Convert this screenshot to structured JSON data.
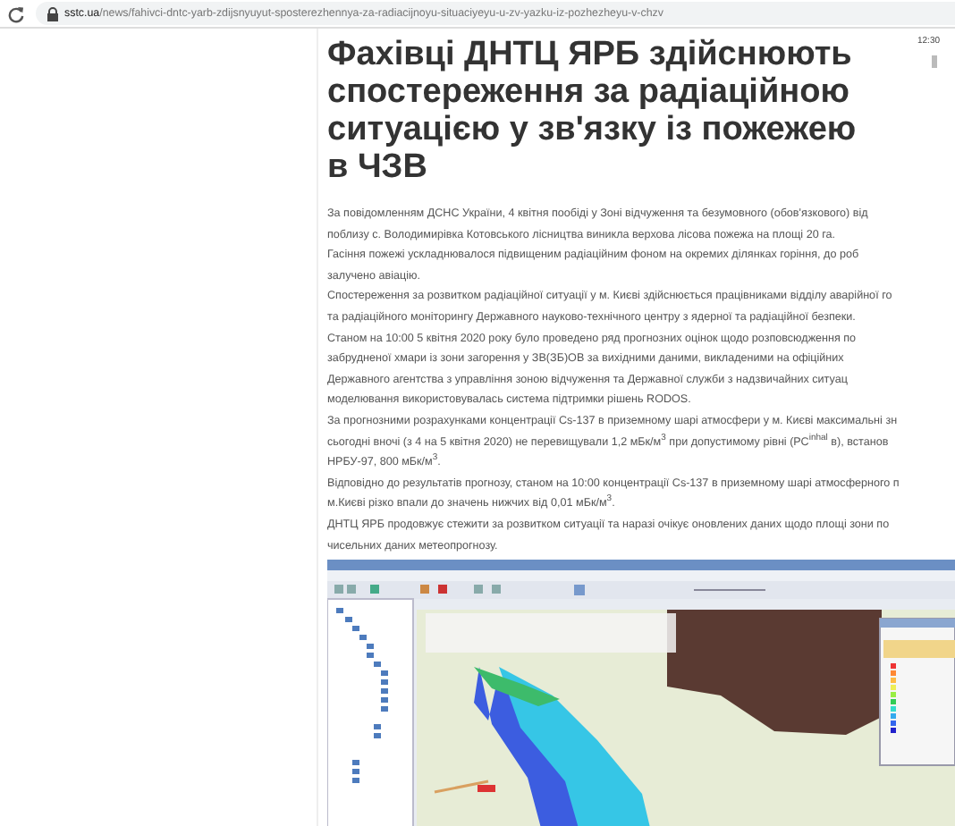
{
  "browser": {
    "url_host": "sstc.ua",
    "url_path": "/news/fahivci-dntc-yarb-zdijsnyuyut-sposterezhennya-za-radiacijnoyu-situaciyeyu-u-zv-yazku-iz-pozhezheyu-v-chzv"
  },
  "side": {
    "time": "12:30"
  },
  "article": {
    "title": "Фахівці ДНТЦ ЯРБ здійснюють спостереження за радіаційною ситуацією у зв'язку із пожежею в ЧЗВ",
    "paragraphs": [
      {
        "lines": [
          "За повідомленням ДСНС України, 4 квітня пообіді у Зоні відчуження та безумовного (обов'язкового) від",
          "поблизу с. Володимирівка Котовського лісництва виникла верхова лісова пожежа на площі 20 га."
        ]
      },
      {
        "lines": [
          "Гасіння пожежі ускладнювалося підвищеним радіаційним фоном на окремих ділянках горіння, до роб",
          "залучено авіацію."
        ]
      },
      {
        "lines": [
          "Спостереження за розвитком радіаційної ситуації у м. Києві здійснюється працівниками відділу аварійної го",
          "та радіаційного моніторингу Державного науково-технічного центру з ядерної та радіаційної безпеки."
        ]
      },
      {
        "lines": [
          "Станом на 10:00 5 квітня 2020 року було проведено ряд прогнозних оцінок щодо розповсюдження по",
          "забрудненої хмари із зони загорення у ЗВ(ЗБ)ОВ за вихідними даними, викладеними на офіційних",
          "Державного агентства з управління зоною відчуження та Державної служби з надзвичайних ситуац",
          "моделювання використовувалась система підтримки рішень RODOS."
        ]
      },
      {
        "lines": [
          "За прогнозними розрахунками концентрації Cs-137 в приземному шарі атмосфери у м. Києві максимальні зн",
          "сьогодні вночі (з 4 на 5 квітня 2020) не перевищували 1,2 мБк/м$^{3}$ при допустимому рівні (РС$^{inhal}$ в), встанов",
          "НРБУ-97, 800 мБк/м$^{3}$."
        ]
      },
      {
        "lines": [
          "Відповідно до результатів прогнозу, станом на 10:00 концентрації Cs-137 в приземному шарі атмосферного п",
          "м.Києві різко впали до значень нижчих від 0,01 мБк/м$^{3}$."
        ]
      },
      {
        "lines": [
          "ДНТЦ ЯРБ продовжує стежити за розвитком ситуації та наразі очікує оновлених даних щодо площі зони по",
          "чисельних даних метеопрогнозу."
        ]
      }
    ]
  }
}
